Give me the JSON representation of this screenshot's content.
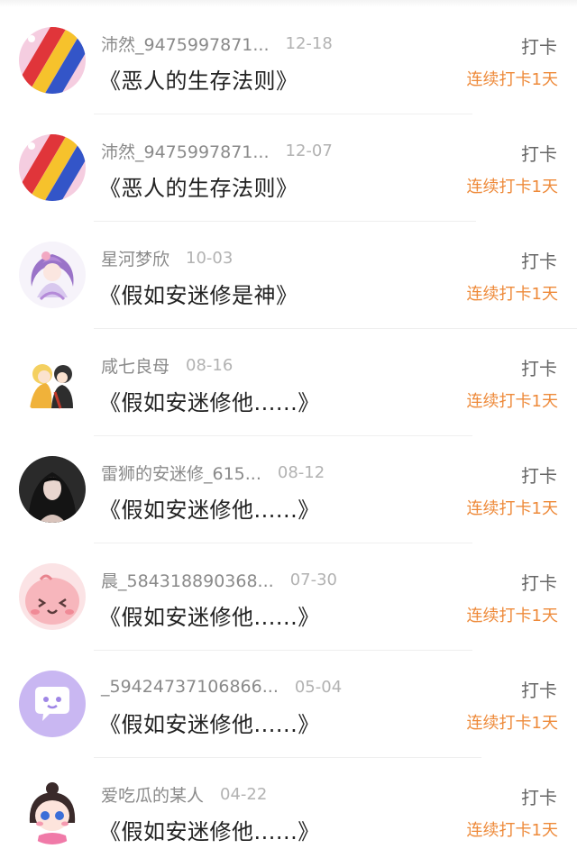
{
  "colors": {
    "name": "#8a8a8a",
    "date": "#b2b2b2",
    "title": "#222222",
    "action": "#666666",
    "streak": "#ee8a3a",
    "divider": "#efefef"
  },
  "items": [
    {
      "name": "沛然_9475997871...",
      "date": "12-18",
      "book": "《恶人的生存法则》",
      "action": "打卡",
      "streak": "连续打卡1天",
      "avatar": "rainbow-avatar"
    },
    {
      "name": "沛然_9475997871...",
      "date": "12-07",
      "book": "《恶人的生存法则》",
      "action": "打卡",
      "streak": "连续打卡1天",
      "avatar": "rainbow-avatar"
    },
    {
      "name": "星河梦欣",
      "date": "10-03",
      "book": "《假如安迷修是神》",
      "action": "打卡",
      "streak": "连续打卡1天",
      "avatar": "anime-girl-avatar"
    },
    {
      "name": "咸七良母",
      "date": "08-16",
      "book": "《假如安迷修他......》",
      "action": "打卡",
      "streak": "连续打卡1天",
      "avatar": "anime-couple-avatar"
    },
    {
      "name": "雷狮的安迷修_615...",
      "date": "08-12",
      "book": "《假如安迷修他......》",
      "action": "打卡",
      "streak": "连续打卡1天",
      "avatar": "dark-photo-avatar"
    },
    {
      "name": "晨_584318890368...",
      "date": "07-30",
      "book": "《假如安迷修他......》",
      "action": "打卡",
      "streak": "连续打卡1天",
      "avatar": "pink-blob-avatar"
    },
    {
      "name": "_59424737106866...",
      "date": "05-04",
      "book": "《假如安迷修他......》",
      "action": "打卡",
      "streak": "连续打卡1天",
      "avatar": "chat-bubble-avatar"
    },
    {
      "name": "爱吃瓜的某人",
      "date": "04-22",
      "book": "《假如安迷修他......》",
      "action": "打卡",
      "streak": "连续打卡1天",
      "avatar": "chibi-girl-avatar"
    }
  ]
}
